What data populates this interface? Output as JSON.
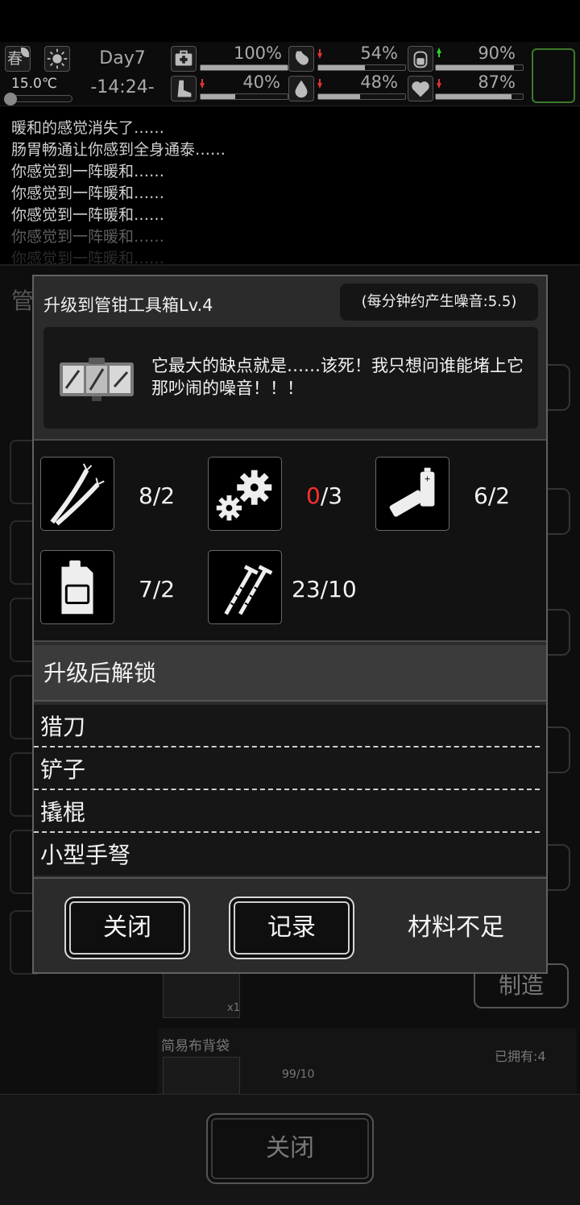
{
  "status": {
    "season": "春",
    "temperature": "15.0℃",
    "day": "Day7",
    "time": "-14:24-",
    "stats": [
      {
        "icon": "medkit-icon",
        "value": "100%",
        "level": 100,
        "trend": "none"
      },
      {
        "icon": "stomach-icon",
        "value": "54%",
        "level": 54,
        "trend": "down"
      },
      {
        "icon": "battery-icon",
        "value": "90%",
        "level": 90,
        "trend": "up"
      },
      {
        "icon": "boot-icon",
        "value": "40%",
        "level": 40,
        "trend": "down"
      },
      {
        "icon": "water-drop-icon",
        "value": "48%",
        "level": 48,
        "trend": "down"
      },
      {
        "icon": "heart-icon",
        "value": "87%",
        "level": 87,
        "trend": "down"
      }
    ]
  },
  "log": [
    "暖和的感觉消失了……",
    "肠胃畅通让你感到全身通泰……",
    "你感觉到一阵暖和……",
    "你感觉到一阵暖和……",
    "你感觉到一阵暖和……",
    "你感觉到一阵暖和……",
    "你感觉到一阵暖和……"
  ],
  "background": {
    "title": "管",
    "craft_button": "制造",
    "item_count": "x1",
    "card_title": "简易布背袋",
    "owned": "已拥有:4",
    "material_count": "99/10",
    "close_button": "关闭"
  },
  "modal": {
    "title": "升级到管钳工具箱Lv.4",
    "noise": "(每分钟约产生噪音:5.5)",
    "description": "它最大的缺点就是……该死！我只想问谁能堵上它那吵闹的噪音！！！",
    "materials": [
      {
        "icon": "wire-icon",
        "have": "8",
        "need": "2",
        "sufficient": true
      },
      {
        "icon": "gears-icon",
        "have": "0",
        "need": "3",
        "sufficient": false
      },
      {
        "icon": "batteries-icon",
        "have": "6",
        "need": "2",
        "sufficient": true
      },
      {
        "icon": "jerrycan-icon",
        "have": "7",
        "need": "2",
        "sufficient": true
      },
      {
        "icon": "screws-icon",
        "have": "23",
        "need": "10",
        "sufficient": true
      }
    ],
    "unlock_header": "升级后解锁",
    "unlocks": [
      "猎刀",
      "铲子",
      "撬棍",
      "小型手弩"
    ],
    "close_button": "关闭",
    "record_button": "记录",
    "status_text": "材料不足"
  }
}
